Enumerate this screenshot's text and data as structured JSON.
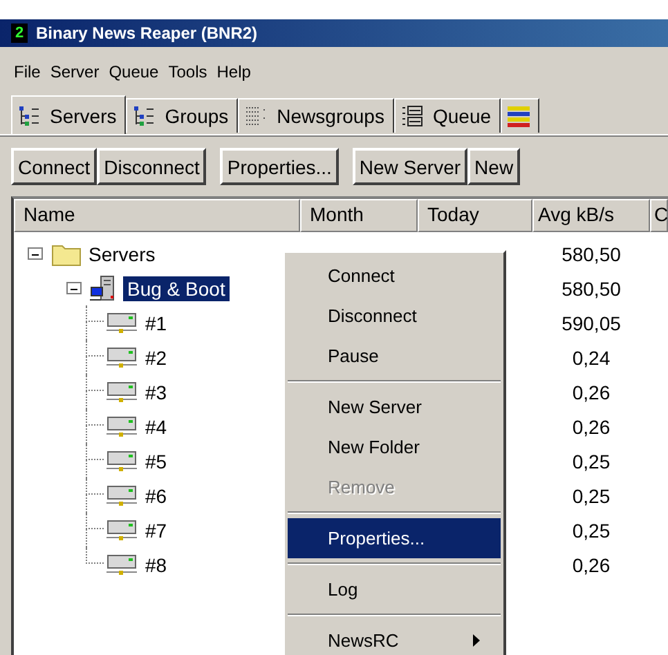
{
  "window": {
    "title": "Binary News Reaper (BNR2)",
    "icon_label": "2"
  },
  "menu_bar": [
    "File",
    "Server",
    "Queue",
    "Tools",
    "Help"
  ],
  "tabs": [
    {
      "label": "Servers",
      "selected": true,
      "kind": "tree"
    },
    {
      "label": "Groups",
      "selected": false,
      "kind": "tree"
    },
    {
      "label": "Newsgroups",
      "selected": false,
      "kind": "grid"
    },
    {
      "label": "Queue",
      "selected": false,
      "kind": "list"
    },
    {
      "selected": false,
      "kind": "bars"
    }
  ],
  "toolbar": [
    [
      "Connect",
      "Disconnect"
    ],
    [
      "Properties..."
    ],
    [
      "New Server",
      "New"
    ]
  ],
  "table": {
    "columns": [
      "Name",
      "Month",
      "Today",
      "Avg kB/s",
      "C"
    ],
    "tree": [
      {
        "name": "Servers",
        "kind": "folder",
        "expanded": true,
        "selected": false,
        "avg": "580,50",
        "children": [
          {
            "name": "Bug & Boot",
            "kind": "server",
            "expanded": true,
            "selected": true,
            "avg": "580,50",
            "children": [
              {
                "name": "#1",
                "kind": "connection",
                "selected": false,
                "avg": "590,05"
              },
              {
                "name": "#2",
                "kind": "connection",
                "selected": false,
                "avg": "0,24"
              },
              {
                "name": "#3",
                "kind": "connection",
                "selected": false,
                "avg": "0,26"
              },
              {
                "name": "#4",
                "kind": "connection",
                "selected": false,
                "avg": "0,26"
              },
              {
                "name": "#5",
                "kind": "connection",
                "selected": false,
                "avg": "0,25"
              },
              {
                "name": "#6",
                "kind": "connection",
                "selected": false,
                "avg": "0,25"
              },
              {
                "name": "#7",
                "kind": "connection",
                "selected": false,
                "avg": "0,25"
              },
              {
                "name": "#8",
                "kind": "connection",
                "selected": false,
                "avg": "0,26"
              }
            ]
          }
        ]
      }
    ]
  },
  "context_menu": [
    [
      {
        "label": "Connect",
        "disabled": false,
        "selected": false,
        "submenu": false
      },
      {
        "label": "Disconnect",
        "disabled": false,
        "selected": false,
        "submenu": false
      },
      {
        "label": "Pause",
        "disabled": false,
        "selected": false,
        "submenu": false
      }
    ],
    [
      {
        "label": "New Server",
        "disabled": false,
        "selected": false,
        "submenu": false
      },
      {
        "label": "New Folder",
        "disabled": false,
        "selected": false,
        "submenu": false
      },
      {
        "label": "Remove",
        "disabled": true,
        "selected": false,
        "submenu": false
      }
    ],
    [
      {
        "label": "Properties...",
        "disabled": false,
        "selected": true,
        "submenu": false
      }
    ],
    [
      {
        "label": "Log",
        "disabled": false,
        "selected": false,
        "submenu": false
      }
    ],
    [
      {
        "label": "NewsRC",
        "disabled": false,
        "selected": false,
        "submenu": true
      }
    ]
  ]
}
